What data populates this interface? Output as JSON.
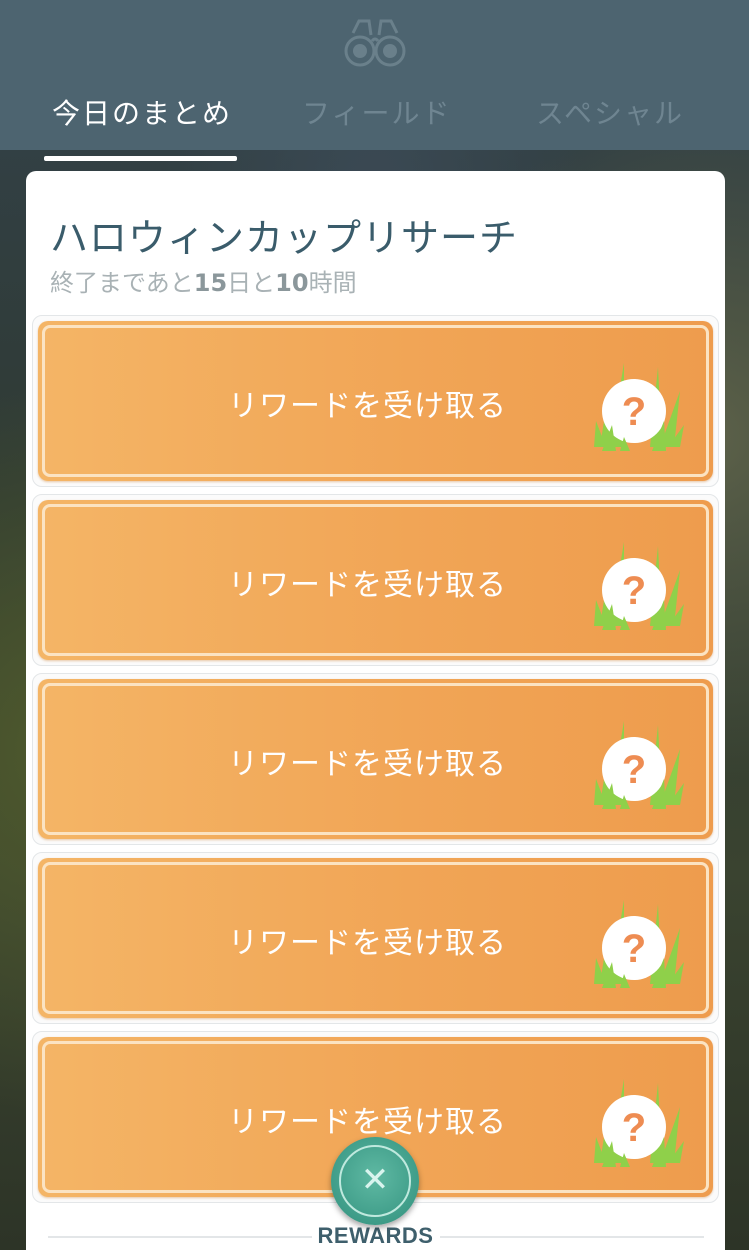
{
  "header": {
    "tabs": [
      {
        "label": "今日のまとめ",
        "active": true
      },
      {
        "label": "フィールド",
        "active": false
      },
      {
        "label": "スペシャル",
        "active": false
      }
    ],
    "icon": "binoculars-icon"
  },
  "research": {
    "title": "ハロウィンカップリサーチ",
    "subtitle_prefix": "終了まであと",
    "days": "15",
    "days_unit": "日と",
    "hours": "10",
    "hours_unit": "時間",
    "rewards": [
      {
        "label": "リワードを受け取る",
        "icon": "mystery-reward-icon"
      },
      {
        "label": "リワードを受け取る",
        "icon": "mystery-reward-icon"
      },
      {
        "label": "リワードを受け取る",
        "icon": "mystery-reward-icon"
      },
      {
        "label": "リワードを受け取る",
        "icon": "mystery-reward-icon"
      },
      {
        "label": "リワードを受け取る",
        "icon": "mystery-reward-icon"
      }
    ],
    "footer_label": "REWARDS",
    "close_symbol": "✕"
  },
  "colors": {
    "header_bg": "#4d6470",
    "reward_button": "#f1a556",
    "title": "#3a5c6b",
    "close_button": "#3e9c88",
    "question_mark": "#ee8c52",
    "grass": "#8fd04a"
  }
}
